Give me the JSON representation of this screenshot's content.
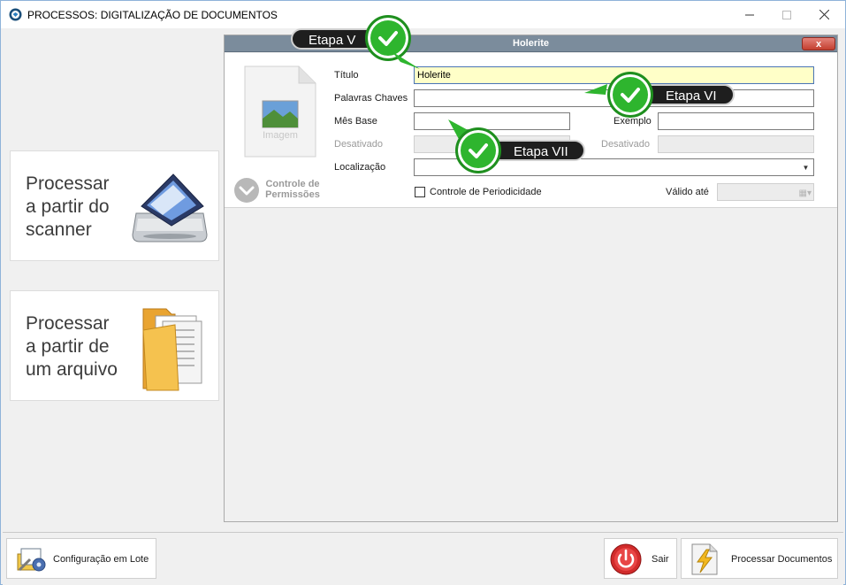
{
  "window": {
    "title": "PROCESSOS: DIGITALIZAÇÃO DE DOCUMENTOS",
    "controls": {
      "minimize": "minimize-icon",
      "maximize": "maximize-icon",
      "close": "close-icon"
    }
  },
  "left_panel": {
    "scanner_button": {
      "label": "Processar a partir do scanner",
      "icon": "scanner-icon"
    },
    "file_button": {
      "label": "Processar a partir de um arquivo",
      "icon": "folder-icon"
    }
  },
  "document_panel": {
    "header_title": "Holerite",
    "close_label": "x",
    "thumbnail_caption": "Imagem",
    "permissions_label": "Controle de Permissões",
    "fields": {
      "titulo": {
        "label": "Título",
        "value": "Holerite"
      },
      "palavras_chaves": {
        "label": "Palavras Chaves",
        "value": ""
      },
      "mes_base": {
        "label": "Mês Base",
        "value": ""
      },
      "exemplo": {
        "label": "Exemplo",
        "value": ""
      },
      "desativado_1": {
        "label": "Desativado",
        "value": ""
      },
      "desativado_2": {
        "label": "Desativado",
        "value": ""
      },
      "localizacao": {
        "label": "Localização",
        "value": ""
      },
      "controle_periodicidade": {
        "label": "Controle de Periodicidade",
        "checked": false
      },
      "valido_ate": {
        "label": "Válido até",
        "value": ""
      }
    }
  },
  "annotations": [
    {
      "label": "Etapa V",
      "icon": "checkmark-icon"
    },
    {
      "label": "Etapa VI",
      "icon": "checkmark-icon"
    },
    {
      "label": "Etapa VII",
      "icon": "checkmark-icon"
    }
  ],
  "bottom_bar": {
    "batch_config": {
      "label": "Configuração em Lote",
      "icon": "batch-config-icon"
    },
    "exit": {
      "label": "Sair",
      "icon": "power-icon"
    },
    "process": {
      "label": "Processar Documentos",
      "icon": "process-documents-icon"
    }
  },
  "colors": {
    "accent_green": "#2eb52e",
    "header_bg": "#7b8c9c",
    "title_field_bg": "#ffffc8",
    "close_red": "#c33f30"
  }
}
